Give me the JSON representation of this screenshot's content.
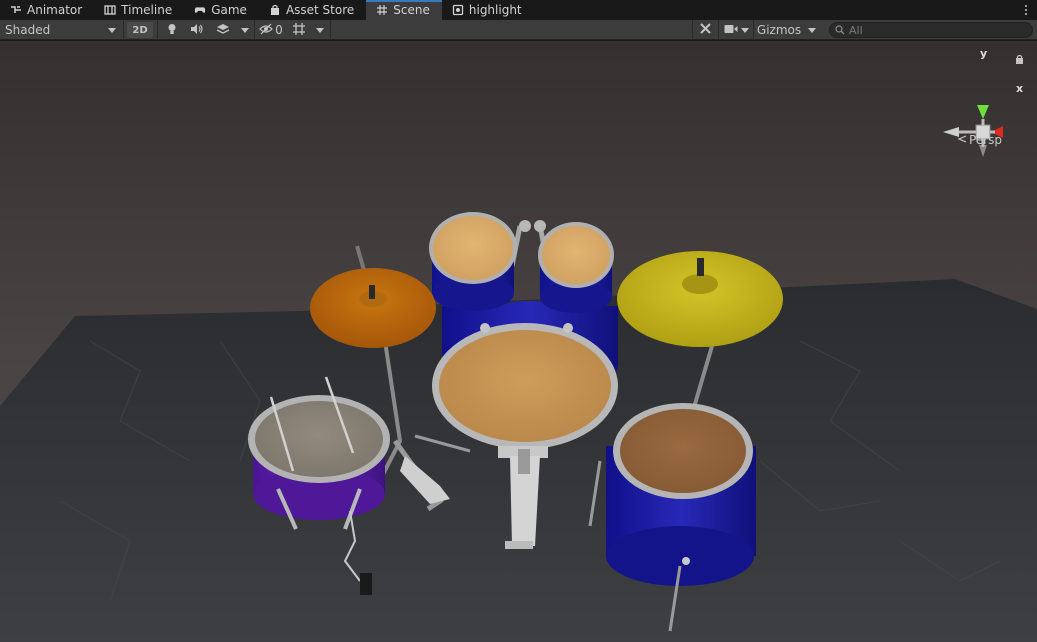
{
  "tabs": [
    {
      "label": "Animator",
      "icon": "animator-icon"
    },
    {
      "label": "Timeline",
      "icon": "timeline-icon"
    },
    {
      "label": "Game",
      "icon": "game-controller-icon"
    },
    {
      "label": "Asset Store",
      "icon": "shopping-bag-icon"
    },
    {
      "label": "Scene",
      "icon": "scene-grid-icon",
      "active": true
    },
    {
      "label": "highlight",
      "icon": "script-icon"
    }
  ],
  "toolbar": {
    "shading_mode": "Shaded",
    "two_d_label": "2D",
    "hidden_count": "0",
    "gizmos_label": "Gizmos",
    "search_placeholder": "All"
  },
  "gizmo": {
    "y_label": "y",
    "x_label": "x",
    "projection_label": "Persp"
  },
  "colors": {
    "active_tab_accent": "#3a79bb",
    "axis_y": "#6ee03c",
    "axis_x": "#e0291f",
    "drum_shell_blue": "#1a1a9a",
    "snare_shell_purple": "#5a1ca8",
    "cymbal_left": "#b5600c",
    "cymbal_right": "#c8b81c"
  }
}
